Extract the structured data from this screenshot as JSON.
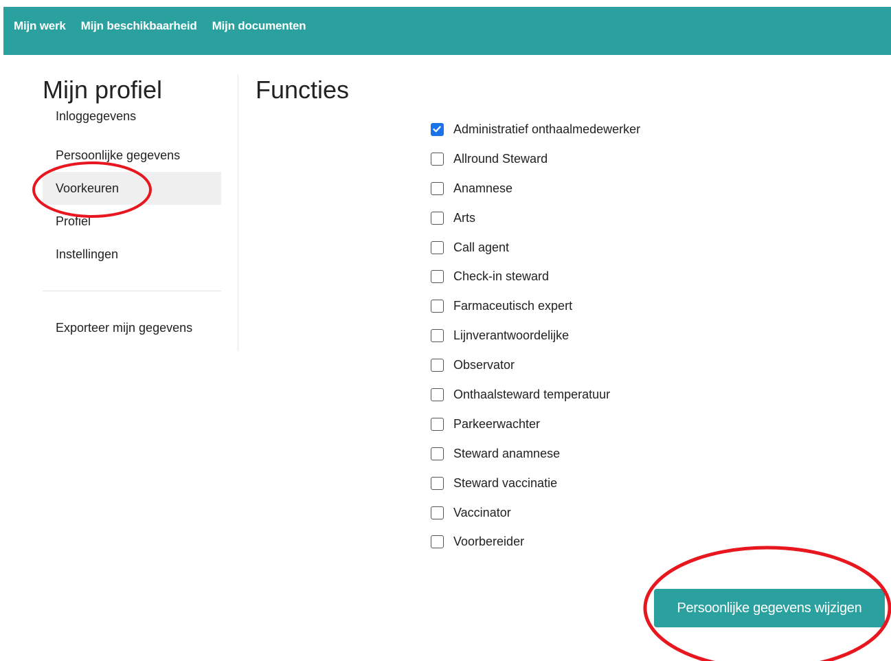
{
  "colors": {
    "nav": "#2aa09f",
    "check": "#1a73e8",
    "annotation": "#e8171f"
  },
  "nav": {
    "links": [
      "Mijn werk",
      "Mijn beschikbaarheid",
      "Mijn documenten"
    ]
  },
  "sidebar": {
    "title": "Mijn profiel",
    "items": [
      {
        "label": "Inloggegevens",
        "active": false
      },
      {
        "label": "Persoonlijke gegevens",
        "active": false
      },
      {
        "label": "Voorkeuren",
        "active": true
      },
      {
        "label": "Profiel",
        "active": false
      },
      {
        "label": "Instellingen",
        "active": false
      }
    ],
    "export_label": "Exporteer mijn gegevens"
  },
  "main": {
    "title": "Functies",
    "functions": [
      {
        "label": "Administratief onthaalmedewerker",
        "checked": true
      },
      {
        "label": "Allround Steward",
        "checked": false
      },
      {
        "label": "Anamnese",
        "checked": false
      },
      {
        "label": "Arts",
        "checked": false
      },
      {
        "label": "Call agent",
        "checked": false
      },
      {
        "label": "Check-in steward",
        "checked": false
      },
      {
        "label": "Farmaceutisch expert",
        "checked": false
      },
      {
        "label": "Lijnverantwoordelijke",
        "checked": false
      },
      {
        "label": "Observator",
        "checked": false
      },
      {
        "label": "Onthaalsteward temperatuur",
        "checked": false
      },
      {
        "label": "Parkeerwachter",
        "checked": false
      },
      {
        "label": "Steward anamnese",
        "checked": false
      },
      {
        "label": "Steward vaccinatie",
        "checked": false
      },
      {
        "label": "Vaccinator",
        "checked": false
      },
      {
        "label": "Voorbereider",
        "checked": false
      }
    ],
    "save_label": "Persoonlijke gegevens wijzigen"
  }
}
